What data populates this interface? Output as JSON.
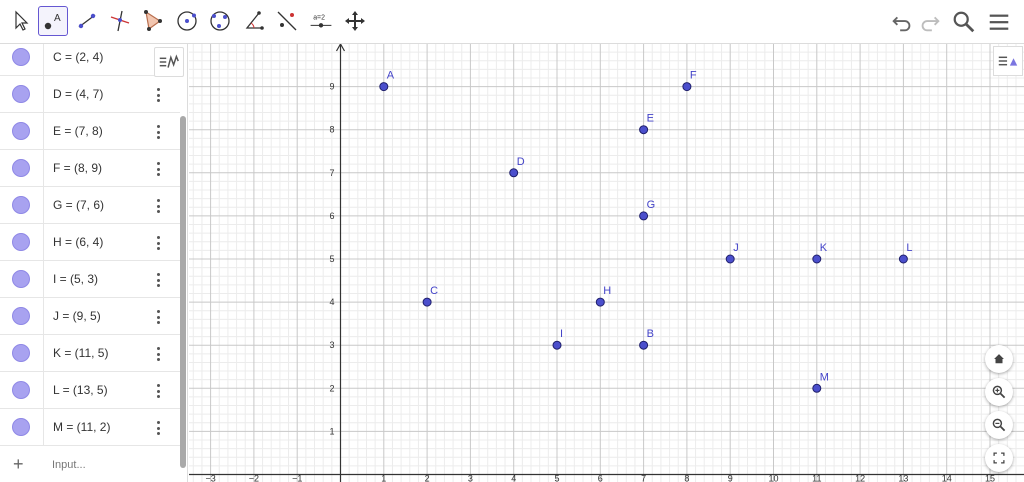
{
  "toolbar": {
    "tools": [
      {
        "id": "move",
        "icon": "move-cursor-icon"
      },
      {
        "id": "point",
        "icon": "point-tool-icon",
        "active": true,
        "label": "A"
      },
      {
        "id": "line",
        "icon": "line-tool-icon"
      },
      {
        "id": "perpendicular",
        "icon": "perpendicular-line-icon"
      },
      {
        "id": "polygon",
        "icon": "polygon-tool-icon"
      },
      {
        "id": "circle-center",
        "icon": "circle-center-point-icon"
      },
      {
        "id": "circle-three",
        "icon": "circle-three-points-icon"
      },
      {
        "id": "angle",
        "icon": "angle-tool-icon"
      },
      {
        "id": "reflect",
        "icon": "reflect-line-icon"
      },
      {
        "id": "slider",
        "icon": "slider-tool-icon",
        "label": "a=2"
      },
      {
        "id": "move-graphics",
        "icon": "move-graphics-icon"
      }
    ],
    "right": [
      "undo-icon",
      "redo-icon",
      "search-icon",
      "menu-icon"
    ]
  },
  "algebra": {
    "items": [
      {
        "label": "C = (2, 4)",
        "menu": false
      },
      {
        "label": "D = (4, 7)",
        "menu": true
      },
      {
        "label": "E = (7, 8)",
        "menu": true
      },
      {
        "label": "F = (8, 9)",
        "menu": true
      },
      {
        "label": "G = (7, 6)",
        "menu": true
      },
      {
        "label": "H = (6, 4)",
        "menu": true
      },
      {
        "label": "I = (5, 3)",
        "menu": true
      },
      {
        "label": "J = (9, 5)",
        "menu": true
      },
      {
        "label": "K = (11, 5)",
        "menu": true
      },
      {
        "label": "L = (13, 5)",
        "menu": true
      },
      {
        "label": "M = (11, 2)",
        "menu": true
      }
    ],
    "input_placeholder": "Input...",
    "add_symbol": "+"
  },
  "graph": {
    "point_color": "#4b4fcc",
    "label_color": "#4343c8",
    "x_ticks": [
      -3,
      -2,
      -1,
      1,
      2,
      3,
      4,
      5,
      6,
      7,
      8,
      9,
      10,
      11,
      12,
      13,
      14,
      15
    ],
    "y_ticks": [
      1,
      2,
      3,
      4,
      5,
      6,
      7,
      8,
      9
    ],
    "points": [
      {
        "name": "A",
        "x": 1,
        "y": 9
      },
      {
        "name": "B",
        "x": 7,
        "y": 3
      },
      {
        "name": "C",
        "x": 2,
        "y": 4
      },
      {
        "name": "D",
        "x": 4,
        "y": 7
      },
      {
        "name": "E",
        "x": 7,
        "y": 8
      },
      {
        "name": "F",
        "x": 8,
        "y": 9
      },
      {
        "name": "G",
        "x": 7,
        "y": 6
      },
      {
        "name": "H",
        "x": 6,
        "y": 4
      },
      {
        "name": "I",
        "x": 5,
        "y": 3
      },
      {
        "name": "J",
        "x": 9,
        "y": 5
      },
      {
        "name": "K",
        "x": 11,
        "y": 5
      },
      {
        "name": "L",
        "x": 13,
        "y": 5
      },
      {
        "name": "M",
        "x": 11,
        "y": 2
      }
    ]
  },
  "graphics_buttons": [
    "home-icon",
    "zoom-in-icon",
    "zoom-out-icon",
    "fullscreen-icon"
  ]
}
